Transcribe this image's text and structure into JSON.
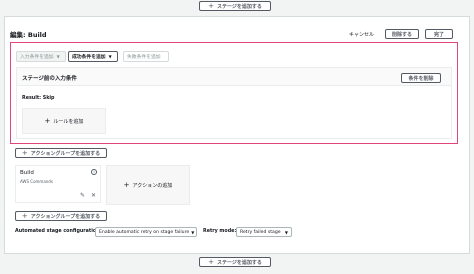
{
  "top_add_stage": "ステージを追加する",
  "bottom_add_stage": "ステージを追加する",
  "edit_title": "編集: Build",
  "header_buttons": {
    "cancel": "キャンセル",
    "delete": "削除する",
    "done": "完了"
  },
  "condition_tabs": [
    {
      "label": "入力条件を追加"
    },
    {
      "label": "成功条件を追加"
    },
    {
      "label": "失敗条件を追加"
    }
  ],
  "entry_section": {
    "title": "ステージ前の入力条件",
    "delete_condition": "条件を削除",
    "result": "Result: Skip",
    "add_rule": "ルールを追加"
  },
  "add_action_group_top": "アクショングループを追加する",
  "add_action_group_bottom": "アクショングループを追加する",
  "action": {
    "name": "Build",
    "provider": "AWS Commands"
  },
  "add_action": "アクションの追加",
  "retry": {
    "auto_label": "Automated stage configuration:",
    "auto_value": "Enable automatic retry on stage failure",
    "mode_label": "Retry mode:",
    "mode_value": "Retry failed stage"
  }
}
